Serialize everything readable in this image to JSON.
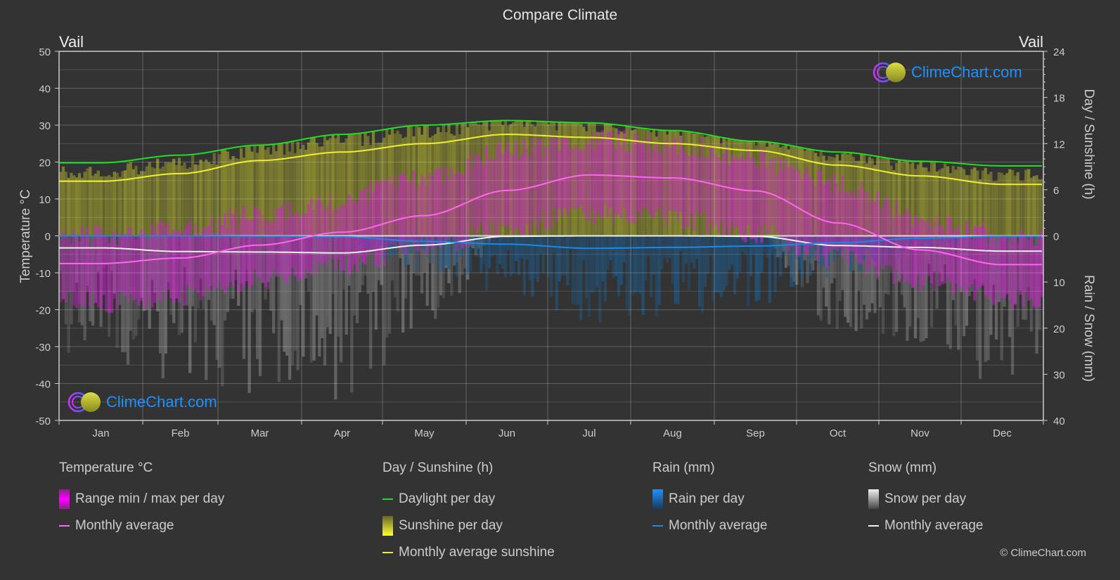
{
  "header": {
    "title": "Compare Climate",
    "city_left": "Vail",
    "city_right": "Vail"
  },
  "axes": {
    "left_title": "Temperature °C",
    "right_top_title": "Day / Sunshine (h)",
    "right_bottom_title": "Rain / Snow (mm)"
  },
  "logo": {
    "text": "ClimeChart.com"
  },
  "legend": {
    "temperature": {
      "heading": "Temperature °C",
      "items": [
        {
          "label": "Range min / max per day"
        },
        {
          "label": "Monthly average"
        }
      ]
    },
    "sunshine": {
      "heading": "Day / Sunshine (h)",
      "items": [
        {
          "label": "Daylight per day"
        },
        {
          "label": "Sunshine per day"
        },
        {
          "label": "Monthly average sunshine"
        }
      ]
    },
    "rain": {
      "heading": "Rain (mm)",
      "items": [
        {
          "label": "Rain per day"
        },
        {
          "label": "Monthly average"
        }
      ]
    },
    "snow": {
      "heading": "Snow (mm)",
      "items": [
        {
          "label": "Snow per day"
        },
        {
          "label": "Monthly average"
        }
      ]
    }
  },
  "copyright": "© ClimeChart.com",
  "colors": {
    "background": "#333333",
    "grid": "#5a5a5a",
    "daylight": "#22dd22",
    "sunshine_avg": "#eeee33",
    "sunshine_fill": "#8a8a30",
    "temp_avg": "#ff66ee",
    "temp_range": "#cc22cc",
    "rain_avg": "#1e88e5",
    "rain_fill": "#1e5a8a",
    "snow_avg": "#eeeeee",
    "snow_fill": "#777777",
    "logo_text": "#1e90ff"
  },
  "chart_data": {
    "type": "line",
    "title": "Compare Climate",
    "categories": [
      "Jan",
      "Feb",
      "Mar",
      "Apr",
      "May",
      "Jun",
      "Jul",
      "Aug",
      "Sep",
      "Oct",
      "Nov",
      "Dec"
    ],
    "left_axis": {
      "label": "Temperature °C",
      "range": [
        -50,
        50
      ],
      "ticks": [
        50,
        40,
        30,
        20,
        10,
        0,
        -10,
        -20,
        -30,
        -40,
        -50
      ]
    },
    "right_axis_top": {
      "label": "Day / Sunshine (h)",
      "range": [
        0,
        24
      ],
      "ticks": [
        24,
        18,
        12,
        6,
        0
      ]
    },
    "right_axis_bottom": {
      "label": "Rain / Snow (mm)",
      "range": [
        0,
        40
      ],
      "ticks": [
        0,
        10,
        20,
        30,
        40
      ]
    },
    "grid": true,
    "series": [
      {
        "name": "Daylight per day",
        "axis": "hours",
        "values": [
          9.5,
          10.5,
          11.8,
          13.2,
          14.4,
          15.0,
          14.7,
          13.7,
          12.3,
          10.9,
          9.7,
          9.1
        ]
      },
      {
        "name": "Monthly average sunshine",
        "axis": "hours",
        "values": [
          7.1,
          8.1,
          9.8,
          10.9,
          12.0,
          13.2,
          12.8,
          12.0,
          11.1,
          9.2,
          7.8,
          6.7
        ]
      },
      {
        "name": "Temperature monthly average",
        "axis": "temperature",
        "values": [
          -7.5,
          -6.0,
          -2.5,
          1.0,
          5.5,
          12.3,
          16.5,
          15.7,
          12.2,
          3.5,
          -3.8,
          -7.8
        ]
      },
      {
        "name": "Temperature max per day (approx.)",
        "axis": "temperature",
        "values": [
          0,
          2,
          6,
          10,
          16,
          23,
          26,
          25,
          21,
          14,
          5,
          0
        ]
      },
      {
        "name": "Temperature min per day (approx.)",
        "axis": "temperature",
        "values": [
          -18,
          -16,
          -12,
          -8,
          -3,
          2,
          6,
          5,
          1,
          -6,
          -12,
          -17
        ]
      },
      {
        "name": "Rain monthly average",
        "axis": "mm",
        "values": [
          0.0,
          0.0,
          0.1,
          0.2,
          1.2,
          1.8,
          2.7,
          2.5,
          2.2,
          1.5,
          0.5,
          0.1
        ]
      },
      {
        "name": "Snow monthly average",
        "axis": "mm",
        "values": [
          2.6,
          3.4,
          3.5,
          3.7,
          2.0,
          0.1,
          0.0,
          0.0,
          0.1,
          2.1,
          2.5,
          3.3
        ]
      }
    ]
  }
}
